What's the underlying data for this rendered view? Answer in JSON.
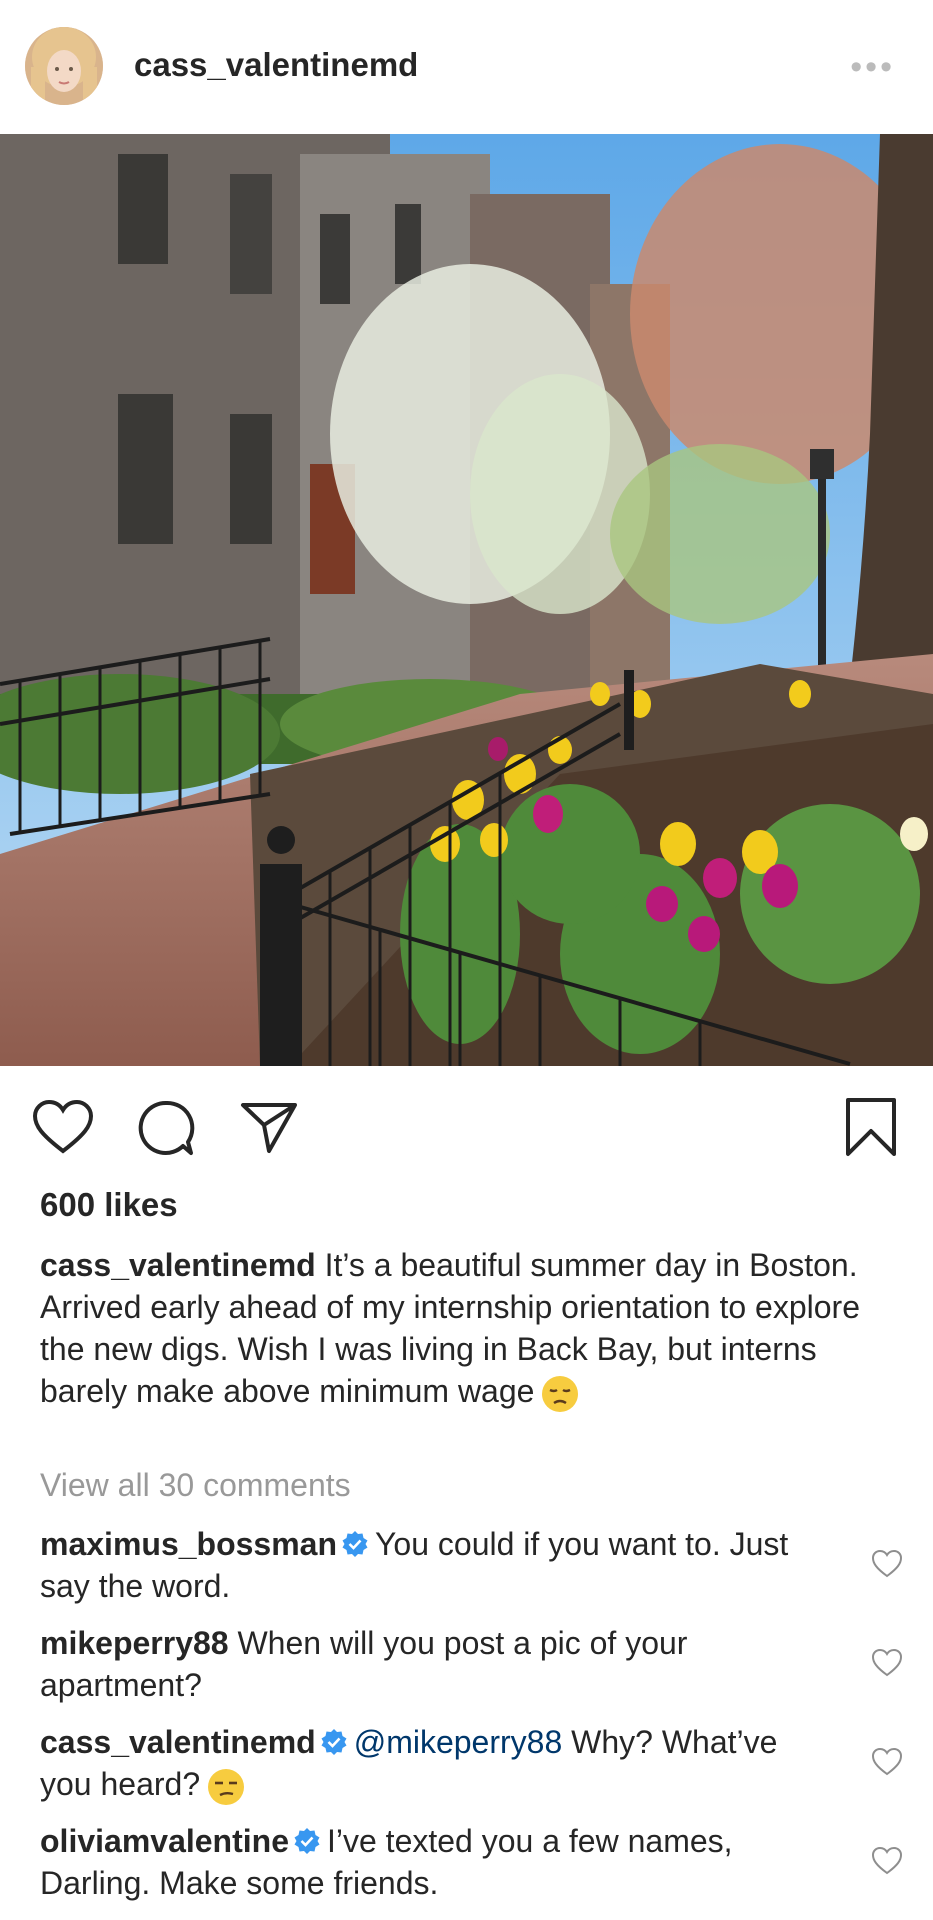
{
  "post": {
    "username": "cass_valentinemd",
    "more_icon": "•••",
    "likes": "600 likes",
    "caption_user": "cass_valentinemd",
    "caption_text": "It’s a beautiful summer day in Boston. Arrived early ahead of my internship orientation to explore the new digs. Wish I was living in Back Bay, but interns barely make above minimum wage",
    "view_all": "View all 30 comments"
  },
  "comments": [
    {
      "user": "maximus_bossman",
      "verified": true,
      "mention": "",
      "text": "You could if you want to. Just say the word."
    },
    {
      "user": "mikeperry88",
      "verified": false,
      "mention": "",
      "text": "When will you post a pic of your apartment?"
    },
    {
      "user": "cass_valentinemd",
      "verified": true,
      "mention": "@mikeperry88",
      "text": "Why? What’ve you heard?"
    },
    {
      "user": "oliviamvalentine",
      "verified": true,
      "mention": "",
      "text": "I’ve texted you a few names, Darling. Make some friends."
    }
  ],
  "icons": {
    "like": "heart-icon",
    "comment": "comment-bubble-icon",
    "share": "paper-plane-icon",
    "save": "bookmark-icon",
    "verified": "verified-badge-icon",
    "emoji_caption": "disappointed-face-emoji",
    "emoji_reply": "unamused-face-emoji"
  },
  "colors": {
    "text": "#262626",
    "muted": "#999999",
    "verified": "#3897f0",
    "mention": "#00376b"
  }
}
